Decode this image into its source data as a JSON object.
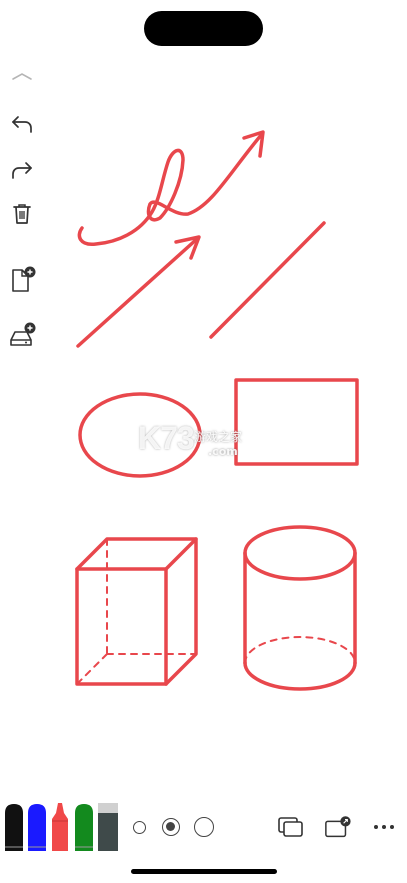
{
  "watermark": {
    "logo": "K73",
    "site_name": "游戏之家",
    "url": ".com"
  },
  "toolbar": {
    "icons": [
      "collapse-chevron-icon",
      "undo-icon",
      "redo-icon",
      "trash-icon",
      "add-page-icon",
      "add-storage-icon"
    ]
  },
  "pens": [
    {
      "name": "black-marker",
      "color": "#111111"
    },
    {
      "name": "blue-marker",
      "color": "#1a1aff"
    },
    {
      "name": "red-marker",
      "color": "#f04848"
    },
    {
      "name": "green-marker",
      "color": "#138a1e"
    },
    {
      "name": "eraser",
      "color": "#3f4a4a"
    }
  ],
  "stroke_sizes": [
    "small",
    "medium",
    "large"
  ],
  "selected_stroke_size": "medium",
  "colors": {
    "ink": "#e8474c",
    "accent": "#e8474c"
  }
}
